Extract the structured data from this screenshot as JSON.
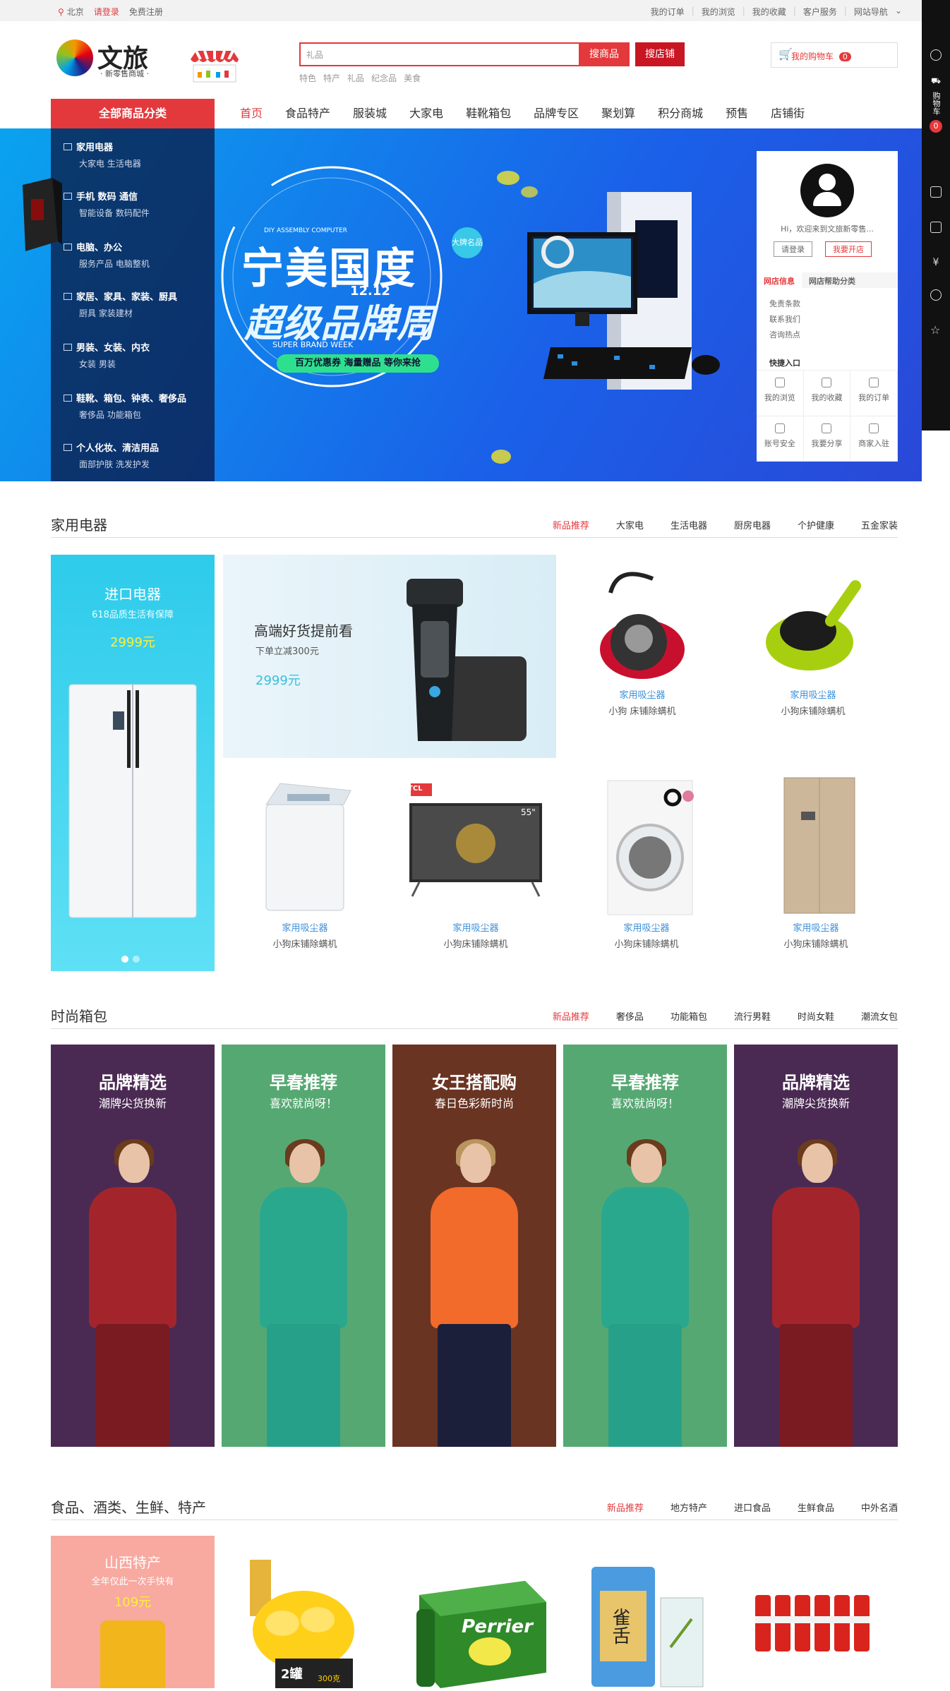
{
  "topbar": {
    "location": "北京",
    "login": "请登录",
    "register": "免费注册",
    "links": [
      "我的订单",
      "我的浏览",
      "我的收藏",
      "客户服务",
      "网站导航"
    ]
  },
  "logo": {
    "name": "文旅",
    "tagline": "· 新零售商城 ·"
  },
  "search": {
    "placeholder": "礼品",
    "btn_product": "搜商品",
    "btn_shop": "搜店铺",
    "hotwords": [
      "特色",
      "特产",
      "礼品",
      "纪念品",
      "美食"
    ]
  },
  "cart": {
    "label": "我的购物车",
    "count": "0"
  },
  "nav": {
    "all_categories": "全部商品分类",
    "items": [
      "首页",
      "食品特产",
      "服装城",
      "大家电",
      "鞋靴箱包",
      "品牌专区",
      "聚划算",
      "积分商城",
      "预售",
      "店铺街"
    ]
  },
  "categories": [
    {
      "title": "家用电器",
      "sub": "大家电  生活电器"
    },
    {
      "title": "手机  数码  通信",
      "sub": "智能设备  数码配件"
    },
    {
      "title": "电脑、办公",
      "sub": "服务产品  电脑整机"
    },
    {
      "title": "家居、家具、家装、厨具",
      "sub": "厨具  家装建材"
    },
    {
      "title": "男装、女装、内衣",
      "sub": "女装  男装"
    },
    {
      "title": "鞋靴、箱包、钟表、奢侈品",
      "sub": "奢侈品  功能箱包"
    },
    {
      "title": "个人化妆、清洁用品",
      "sub": "面部护肤  洗发护发"
    }
  ],
  "banner": {
    "small": "DIY ASSEMBLY COMPUTER",
    "line1": "宁美国度",
    "badge": "大牌名品",
    "date": "12.12",
    "line2": "超级品牌周",
    "en": "SUPER BRAND WEEK",
    "pill": "百万优惠券 海量赠品 等你来抢"
  },
  "userpanel": {
    "hi": "Hi，欢迎来到文旅新零售...",
    "login": "请登录",
    "open": "我要开店",
    "tab1": "网店信息",
    "tab2": "网店帮助分类",
    "links": [
      "免责条款",
      "联系我们",
      "咨询热点"
    ],
    "quick": "快捷入口",
    "grid": [
      "我的浏览",
      "我的收藏",
      "我的订单",
      "账号安全",
      "我要分享",
      "商家入驻"
    ]
  },
  "sidebar": {
    "cart": "购物车",
    "count": "0"
  },
  "sec1": {
    "title": "家用电器",
    "tabs": [
      "新品推荐",
      "大家电",
      "生活电器",
      "厨房电器",
      "个护健康",
      "五金家装"
    ],
    "promo": {
      "title": "进口电器",
      "sub": "618品质生活有保障",
      "price": "2999元"
    },
    "feature": {
      "title": "高端好货提前看",
      "sub": "下单立减300元",
      "price": "2999元"
    },
    "products": [
      {
        "t1": "家用吸尘器",
        "t2": "小狗 床铺除螨机"
      },
      {
        "t1": "家用吸尘器",
        "t2": "小狗床铺除螨机"
      },
      {
        "t1": "家用吸尘器",
        "t2": "小狗床铺除螨机"
      },
      {
        "t1": "家用吸尘器",
        "t2": "小狗床铺除螨机"
      },
      {
        "t1": "家用吸尘器",
        "t2": "小狗床铺除螨机"
      },
      {
        "t1": "家用吸尘器",
        "t2": "小狗床铺除螨机"
      }
    ],
    "tv_brand": "TCL",
    "tv_size": "55\""
  },
  "sec2": {
    "title": "时尚箱包",
    "tabs": [
      "新品推荐",
      "奢侈品",
      "功能箱包",
      "流行男鞋",
      "时尚女鞋",
      "潮流女包"
    ],
    "cards": [
      {
        "h1": "品牌精选",
        "h2": "潮牌尖货换新",
        "bg": "#4a2a52"
      },
      {
        "h1": "早春推荐",
        "h2": "喜欢就尚呀！",
        "bg": "#56a872"
      },
      {
        "h1": "女王搭配购",
        "h2": "春日色彩新时尚",
        "bg": "#6a3422"
      },
      {
        "h1": "早春推荐",
        "h2": "喜欢就尚呀！",
        "bg": "#56a872"
      },
      {
        "h1": "品牌精选",
        "h2": "潮牌尖货换新",
        "bg": "#4a2a52"
      }
    ]
  },
  "sec3": {
    "title": "食品、酒类、生鲜、特产",
    "tabs": [
      "新品推荐",
      "地方特产",
      "进口食品",
      "生鲜食品",
      "中外名酒"
    ],
    "promo": {
      "title": "山西特产",
      "sub": "全年仅此一次手快有",
      "price": "109元"
    },
    "can_label": "2罐",
    "can_price": "300克",
    "tea_label": "雀舌",
    "perrier": "Perrier"
  }
}
